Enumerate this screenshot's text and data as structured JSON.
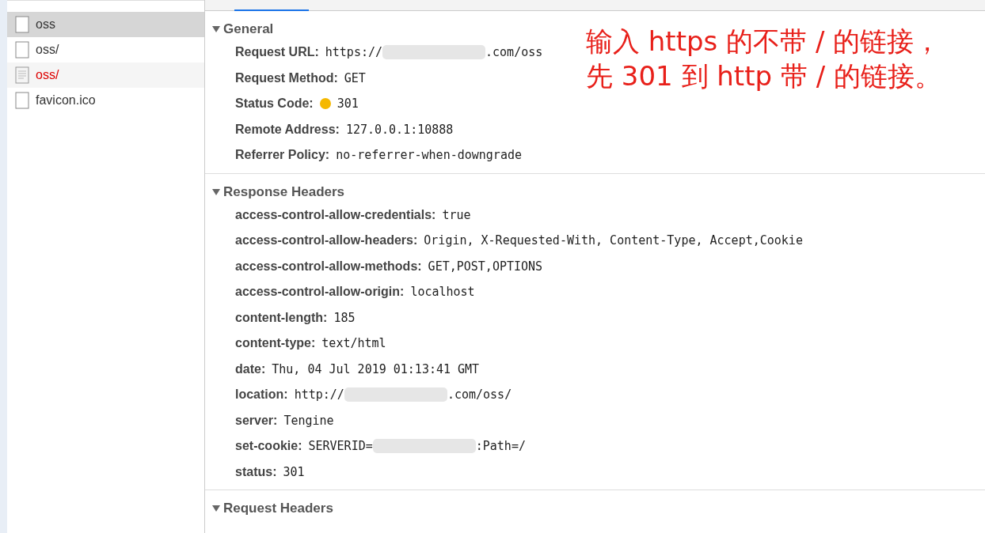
{
  "requests": [
    {
      "name": "oss",
      "selected": true,
      "error": false,
      "kind": "blank"
    },
    {
      "name": "oss/",
      "selected": false,
      "error": false,
      "kind": "blank"
    },
    {
      "name": "oss/",
      "selected": false,
      "error": true,
      "kind": "document"
    },
    {
      "name": "favicon.ico",
      "selected": false,
      "error": false,
      "kind": "blank"
    }
  ],
  "sections": [
    {
      "title": "General",
      "expanded": true,
      "rows": [
        {
          "label": "Request URL:",
          "value": "https://",
          "redacted": true,
          "value_end": ".com/oss"
        },
        {
          "label": "Request Method:",
          "value": "GET"
        },
        {
          "label": "Status Code:",
          "value": "301",
          "color": "#f5b800"
        },
        {
          "label": "Remote Address:",
          "value": "127.0.0.1:10888"
        },
        {
          "label": "Referrer Policy:",
          "value": "no-referrer-when-downgrade"
        }
      ]
    },
    {
      "title": "Response Headers",
      "expanded": true,
      "rows": [
        {
          "label": "access-control-allow-credentials:",
          "value": "true"
        },
        {
          "label": "access-control-allow-headers:",
          "value": "Origin, X-Requested-With, Content-Type, Accept,Cookie"
        },
        {
          "label": "access-control-allow-methods:",
          "value": "GET,POST,OPTIONS"
        },
        {
          "label": "access-control-allow-origin:",
          "value": "localhost"
        },
        {
          "label": "content-length:",
          "value": "185"
        },
        {
          "label": "content-type:",
          "value": "text/html"
        },
        {
          "label": "date:",
          "value": "Thu, 04 Jul 2019 01:13:41 GMT"
        },
        {
          "label": "location:",
          "value": "http://",
          "redacted": true,
          "value_end": ".com/oss/"
        },
        {
          "label": "server:",
          "value": "Tengine"
        },
        {
          "label": "set-cookie:",
          "value": "SERVERID=",
          "redacted": true,
          "value_end": ":Path=/"
        },
        {
          "label": "status:",
          "value": "301"
        }
      ]
    },
    {
      "title": "Request Headers",
      "expanded": true
    }
  ],
  "annotation": [
    "输入 https 的不带 / 的链接，",
    "先 301 到 http 带 / 的链接。"
  ]
}
